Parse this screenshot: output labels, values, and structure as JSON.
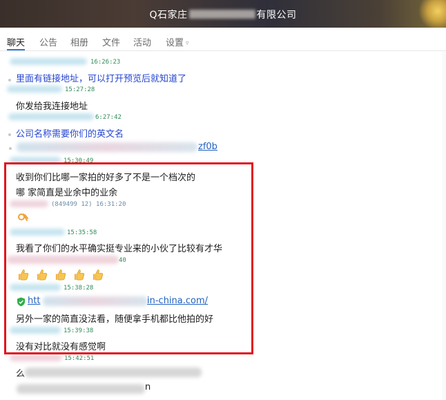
{
  "window": {
    "title_prefix": "Q石家庄",
    "title_suffix": "有限公司"
  },
  "tabs": [
    {
      "label": "聊天"
    },
    {
      "label": "公告"
    },
    {
      "label": "相册"
    },
    {
      "label": "文件"
    },
    {
      "label": "活动"
    },
    {
      "label": "设置"
    }
  ],
  "messages": {
    "t1": "16:26:23",
    "m1": "里面有链接地址，可以打开预览后就知道了",
    "t2": "15:27:28",
    "m2": "你发给我连接地址",
    "t3": "6:27:42",
    "m3": "公司名称需要你们的英文名",
    "m4_tail": "zf0b",
    "t4": "15:30:49",
    "m5": "收到你们比哪一家拍的好多了不是一个档次的",
    "m6": "哪   家简直是业余中的业余",
    "t5": "(849499 12)  16:31:20",
    "t6": "15:35:58",
    "m7": "我看了你们的水平确实挺专业来的小伙了比较有才华",
    "t7": "40",
    "t8": "15:38:28",
    "m8_head": "htt",
    "m8_tail": "in-china.com/",
    "m9": "另外一家的简直没法看，随便拿手机都比他拍的好",
    "t9": "15:39:38",
    "m10": "没有对比就没有感觉啊",
    "t10": "15:42:51",
    "m11_head": "么",
    "m12_tail": "n"
  },
  "icons": {
    "ok_hand": "ok-hand-emoji",
    "thumbs": "thumbs-up-emoji",
    "verified": "shield-check-icon",
    "dropdown": "chevron-down-icon"
  },
  "colors": {
    "highlight": "#e0141c",
    "tab_accent": "#2a79d8",
    "timestamp": "#2e8b57",
    "link": "#2060c0",
    "quoted_text": "#2646d0"
  }
}
